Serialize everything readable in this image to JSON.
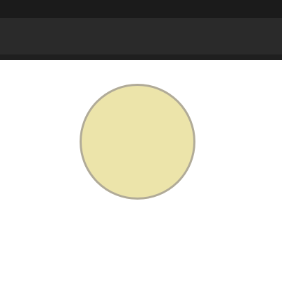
{
  "window": {
    "title": "",
    "toolbar_label": ""
  },
  "canvas": {
    "shape": "circle",
    "fill_color": "#ece4aa",
    "stroke_color": "#b1ab98"
  }
}
